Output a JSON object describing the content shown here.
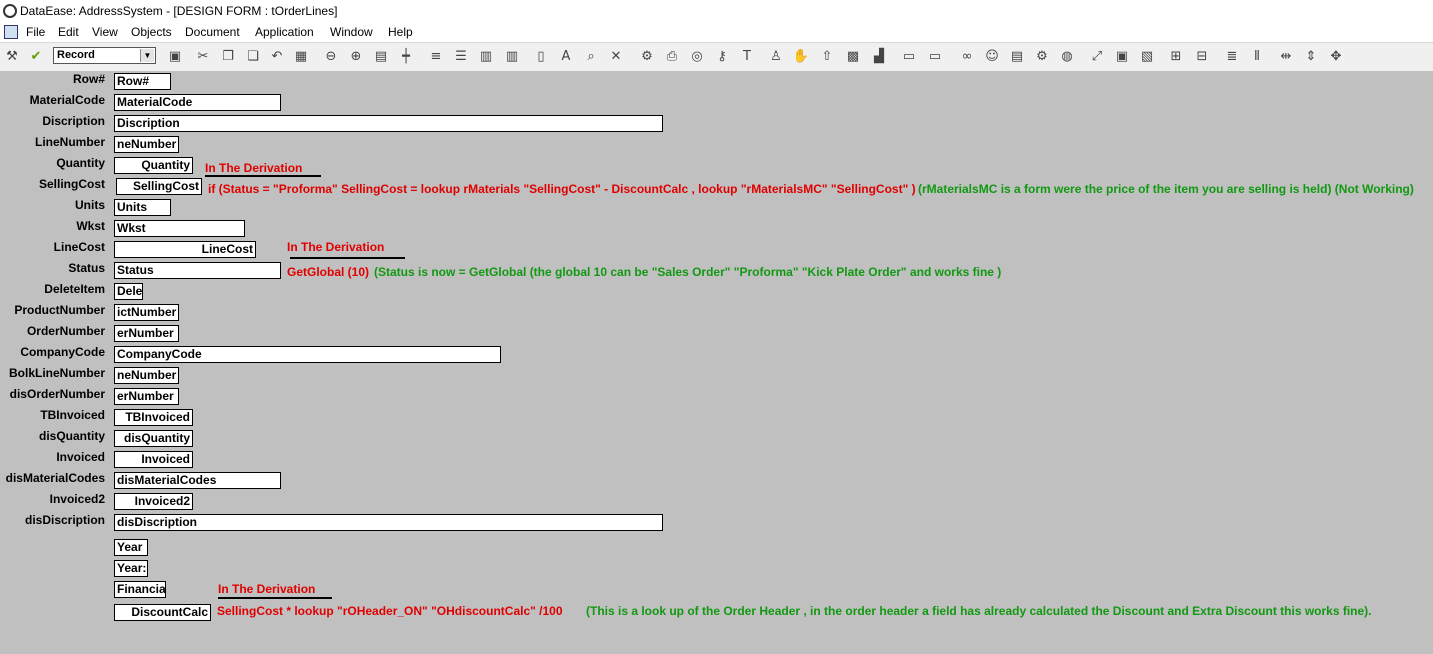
{
  "window": {
    "title": "DataEase: AddressSystem - [DESIGN FORM : tOrderLines]"
  },
  "menu": [
    "File",
    "Edit",
    "View",
    "Objects",
    "Document",
    "Application",
    "Window",
    "Help"
  ],
  "toolbar": {
    "mode_select": "Record",
    "icons": [
      "wand-icon",
      "check-icon",
      "save-icon",
      "cut-icon",
      "copy-icon",
      "paste-icon",
      "undo-icon",
      "grid-icon",
      "zoom-out-icon",
      "zoom-in-icon",
      "fill-icon",
      "pointer-icon",
      "align-left-icon",
      "align-justify-icon",
      "bars-icon",
      "bars2-icon",
      "page-icon",
      "text-a-icon",
      "search-icon",
      "cross-icon",
      "tools-icon",
      "print-icon",
      "disc-icon",
      "key-icon",
      "t-icon",
      "person-icon",
      "hand-icon",
      "arrow-up-icon",
      "checker-icon",
      "chart-icon",
      "window-icon",
      "window2-icon",
      "binoculars-icon",
      "smiley-icon",
      "doc-icon",
      "gear-icon",
      "globe-icon",
      "resize-icon",
      "frame-icon",
      "split-icon",
      "vbar-icon",
      "vbar2-icon",
      "lines-icon",
      "columns-icon",
      "hspace-icon",
      "vspace-icon",
      "move-icon"
    ]
  },
  "form": {
    "labels": [
      "Row#",
      "MaterialCode",
      "Discription",
      "LineNumber",
      "Quantity",
      "SellingCost",
      "Units",
      "Wkst",
      "LineCost",
      "Status",
      "DeleteItem",
      "ProductNumber",
      "OrderNumber",
      "CompanyCode",
      "BolkLineNumber",
      "disOrderNumber",
      "TBInvoiced",
      "disQuantity",
      "Invoiced",
      "disMaterialCodes",
      "Invoiced2",
      "disDiscription"
    ],
    "fields": [
      "Row#",
      "MaterialCode",
      "Discription",
      "neNumber",
      "Quantity",
      "SellingCost",
      "Units",
      "Wkst",
      "LineCost",
      "Status",
      "Dele",
      "ictNumber",
      "erNumber",
      "CompanyCode",
      "neNumber",
      "erNumber",
      "TBInvoiced",
      "disQuantity",
      "Invoiced",
      "disMaterialCodes",
      "Invoiced2",
      "disDiscription",
      "Year",
      "Year:",
      "Financia",
      "DiscountCalc"
    ],
    "notes": {
      "quantity": "In The Derivation",
      "sellingcost": "if (Status  = \"Proforma\" SellingCost = lookup rMaterials \"SellingCost\" - DiscountCalc , lookup \"rMaterialsMC\" \"SellingCost\" )",
      "sellingcost_comment": "(rMaterialsMC is a form were the price of the item you are selling is held)    (Not Working)",
      "linecost": "In The Derivation",
      "status": "GetGlobal (10)",
      "status_comment": "(Status is now = GetGlobal (the global 10 can be \"Sales Order\" \"Proforma\" \"Kick Plate Order\" and works fine )",
      "financia": "In The Derivation",
      "discount": "SellingCost * lookup \"rOHeader_ON\"   \"OHdiscountCalc\"  /100",
      "discount_comment": "(This is a look up of the Order Header , in the order header a field has already calculated the Discount and Extra Discount this works fine)."
    }
  }
}
